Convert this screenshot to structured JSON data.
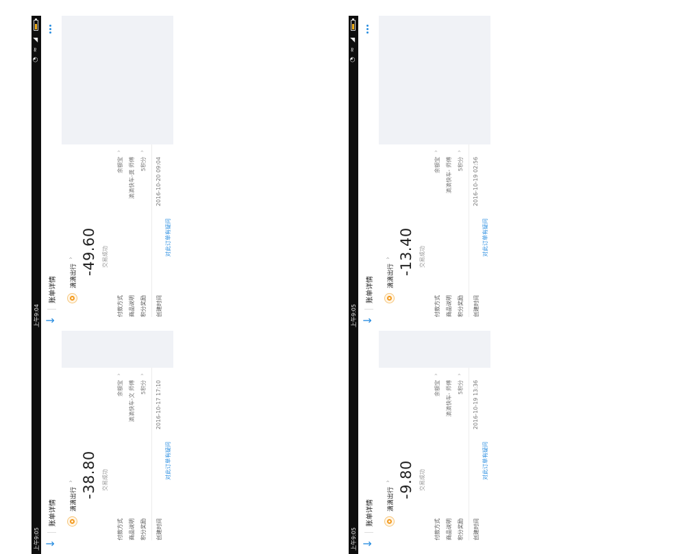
{
  "panels": [
    {
      "status_time": "上午9:05",
      "title": "账单详情",
      "merchant": "滴滴出行",
      "amount": "-38.80",
      "status": "交易成功",
      "rows": [
        {
          "label": "付款方式",
          "value": "余额宝"
        },
        {
          "label": "商品说明",
          "value": "滴滴快车-文   师傅"
        },
        {
          "label": "积分奖励",
          "value": "5积分"
        },
        {
          "label": "创建时间",
          "value": "2016-10-17 17:10"
        }
      ],
      "link": "对此订单有疑问"
    },
    {
      "status_time": "上午9:05",
      "title": "账单详情",
      "merchant": "滴滴出行",
      "amount": "-9.80",
      "status": "交易成功",
      "rows": [
        {
          "label": "付款方式",
          "value": "余额宝"
        },
        {
          "label": "商品说明",
          "value": "滴滴快车-   师傅"
        },
        {
          "label": "积分奖励",
          "value": "5积分"
        },
        {
          "label": "创建时间",
          "value": "2016-10-19 13:36"
        }
      ],
      "link": "对此订单有疑问"
    },
    {
      "status_time": "上午9:04",
      "title": "账单详情",
      "merchant": "滴滴出行",
      "amount": "-49.60",
      "status": "交易成功",
      "rows": [
        {
          "label": "付款方式",
          "value": "余额宝"
        },
        {
          "label": "商品说明",
          "value": "滴滴快车-龚   师傅"
        },
        {
          "label": "积分奖励",
          "value": "5积分"
        },
        {
          "label": "创建时间",
          "value": "2016-10-20 09:04"
        }
      ],
      "link": "对此订单有疑问"
    },
    {
      "status_time": "上午9:05",
      "title": "账单详情",
      "merchant": "滴滴出行",
      "amount": "-13.40",
      "status": "交易成功",
      "rows": [
        {
          "label": "付款方式",
          "value": "余额宝"
        },
        {
          "label": "商品说明",
          "value": "滴滴快车-   师傅"
        },
        {
          "label": "积分奖励",
          "value": "5积分"
        },
        {
          "label": "创建时间",
          "value": "2016-10-19 02:56"
        }
      ],
      "link": "对此订单有疑问"
    }
  ],
  "icons": {
    "back": "arrow-back-icon",
    "more": "more-dots-icon",
    "merchant_logo": "didi-logo-icon",
    "chevron": "chevron-right-icon"
  },
  "colors": {
    "accent": "#2a8ee0",
    "status_bar": "#0e0e0e",
    "gray_area": "#f0f2f6",
    "logo_orange": "#f39a1e"
  }
}
